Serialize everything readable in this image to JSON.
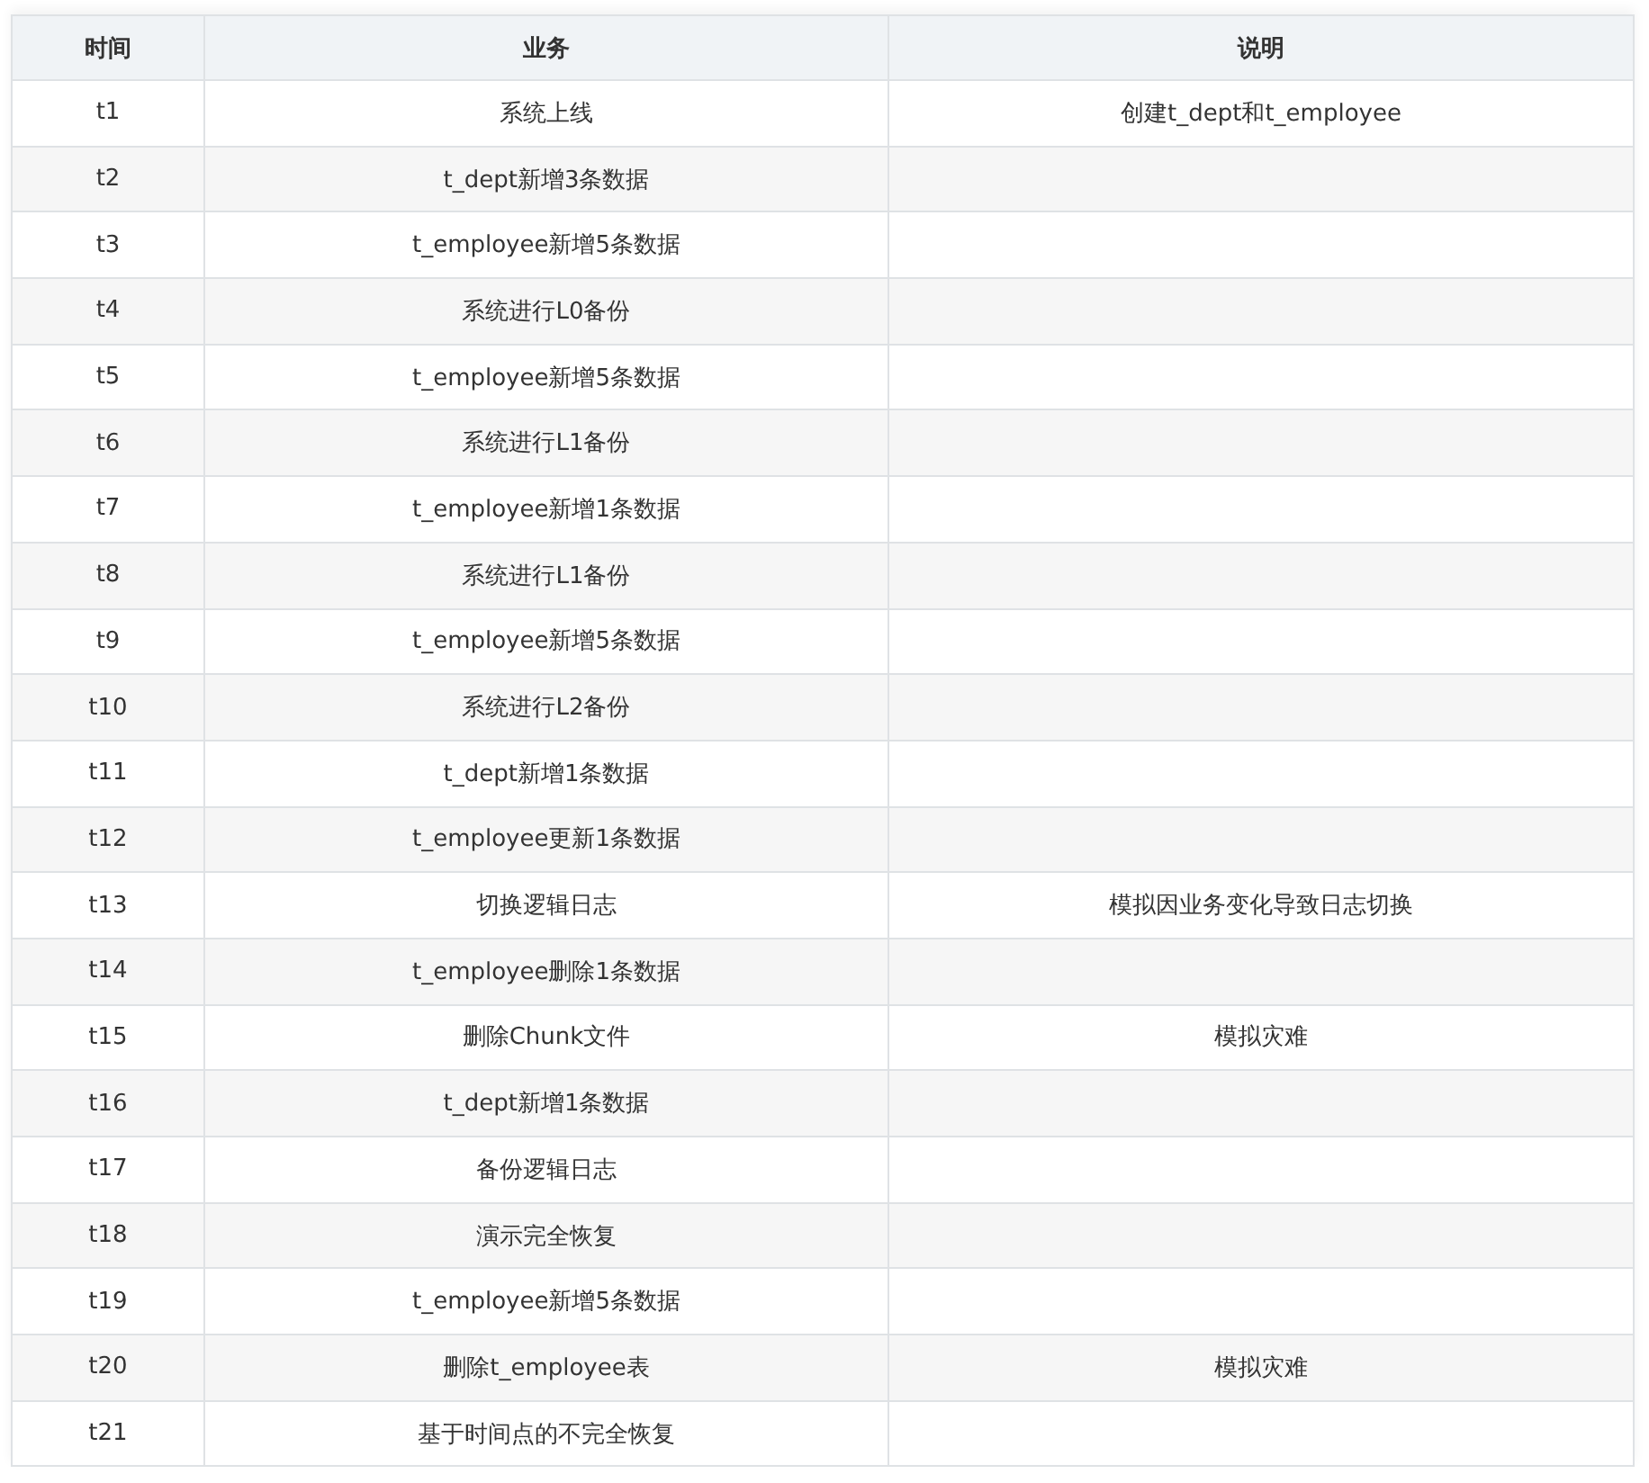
{
  "table": {
    "columns": [
      "时间",
      "业务",
      "说明"
    ],
    "rows": [
      {
        "time": "t1",
        "task": "系统上线",
        "note": "创建t_dept和t_employee"
      },
      {
        "time": "t2",
        "task": "t_dept新增3条数据"
      },
      {
        "time": "t3",
        "task": "t_employee新增5条数据"
      },
      {
        "time": "t4",
        "task": "系统进行L0备份"
      },
      {
        "time": "t5",
        "task": "t_employee新增5条数据"
      },
      {
        "time": "t6",
        "task": "系统进行L1备份"
      },
      {
        "time": "t7",
        "task": "t_employee新增1条数据"
      },
      {
        "time": "t8",
        "task": "系统进行L1备份"
      },
      {
        "time": "t9",
        "task": "t_employee新增5条数据"
      },
      {
        "time": "t10",
        "task": "系统进行L2备份"
      },
      {
        "time": "t11",
        "task": "t_dept新增1条数据"
      },
      {
        "time": "t12",
        "task": "t_employee更新1条数据"
      },
      {
        "time": "t13",
        "task": "切换逻辑日志",
        "note": "模拟因业务变化导致日志切换"
      },
      {
        "time": "t14",
        "task": "t_employee删除1条数据"
      },
      {
        "time": "t15",
        "task": "删除Chunk文件",
        "note": "模拟灾难"
      },
      {
        "time": "t16",
        "task": "t_dept新增1条数据"
      },
      {
        "time": "t17",
        "task": "备份逻辑日志"
      },
      {
        "time": "t18",
        "task": "演示完全恢复"
      },
      {
        "time": "t19",
        "task": "t_employee新增5条数据"
      },
      {
        "time": "t20",
        "task": "删除t_employee表",
        "note": "模拟灾难"
      },
      {
        "time": "t21",
        "task": "基于时间点的不完全恢复"
      }
    ]
  }
}
